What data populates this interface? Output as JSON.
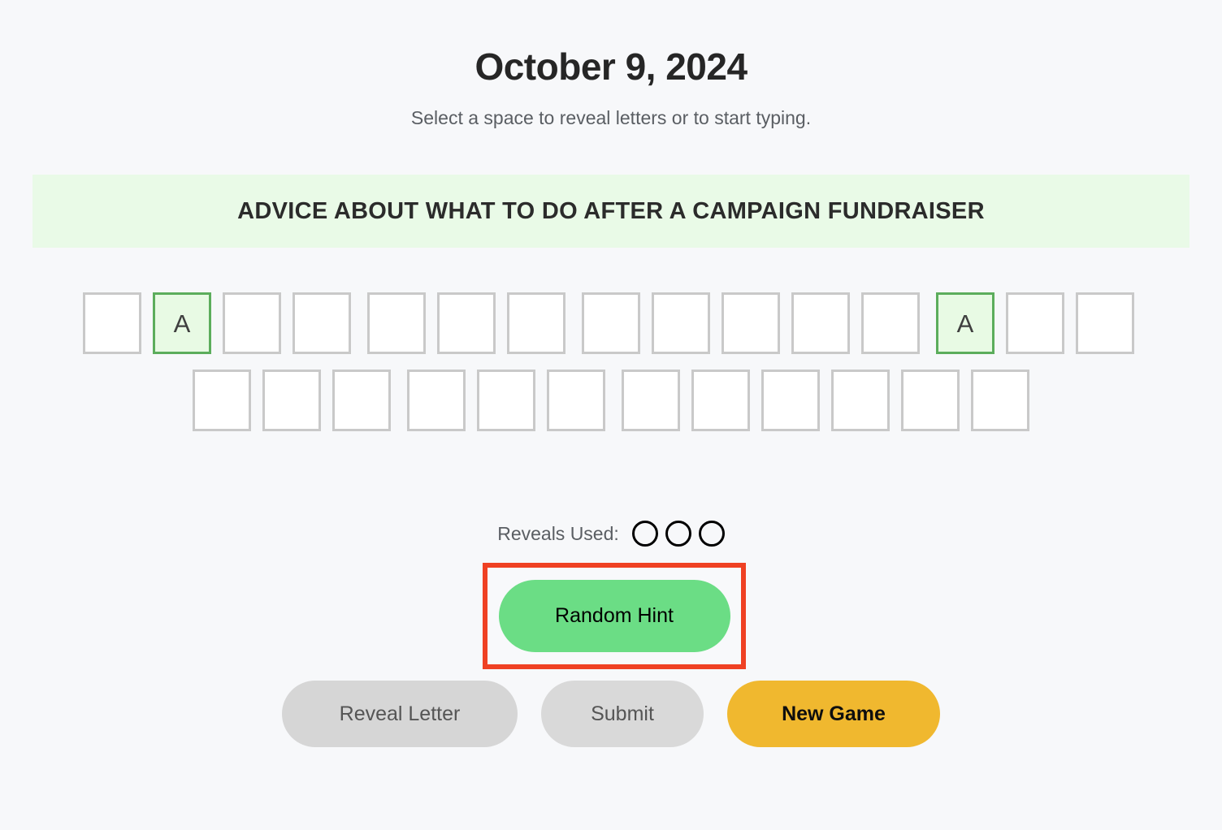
{
  "header": {
    "title": "October 9, 2024",
    "subtitle": "Select a space to reveal letters or to start typing."
  },
  "clue": {
    "text": "ADVICE ABOUT WHAT TO DO AFTER A CAMPAIGN FUNDRAISER",
    "background_color": "#E9FAE7"
  },
  "puzzle": {
    "rows": [
      {
        "groups": [
          {
            "cells": [
              {
                "letter": "",
                "revealed": false
              },
              {
                "letter": "A",
                "revealed": true
              },
              {
                "letter": "",
                "revealed": false
              },
              {
                "letter": "",
                "revealed": false
              }
            ]
          },
          {
            "cells": [
              {
                "letter": "",
                "revealed": false
              },
              {
                "letter": "",
                "revealed": false
              },
              {
                "letter": "",
                "revealed": false
              }
            ]
          },
          {
            "cells": [
              {
                "letter": "",
                "revealed": false
              },
              {
                "letter": "",
                "revealed": false
              },
              {
                "letter": "",
                "revealed": false
              },
              {
                "letter": "",
                "revealed": false
              },
              {
                "letter": "",
                "revealed": false
              }
            ]
          },
          {
            "cells": [
              {
                "letter": "A",
                "revealed": true
              },
              {
                "letter": "",
                "revealed": false
              },
              {
                "letter": "",
                "revealed": false
              }
            ]
          }
        ]
      },
      {
        "groups": [
          {
            "cells": [
              {
                "letter": "",
                "revealed": false
              },
              {
                "letter": "",
                "revealed": false
              },
              {
                "letter": "",
                "revealed": false
              }
            ]
          },
          {
            "cells": [
              {
                "letter": "",
                "revealed": false
              },
              {
                "letter": "",
                "revealed": false
              },
              {
                "letter": "",
                "revealed": false
              }
            ]
          },
          {
            "cells": [
              {
                "letter": "",
                "revealed": false
              },
              {
                "letter": "",
                "revealed": false
              },
              {
                "letter": "",
                "revealed": false
              },
              {
                "letter": "",
                "revealed": false
              },
              {
                "letter": "",
                "revealed": false
              },
              {
                "letter": "",
                "revealed": false
              }
            ]
          }
        ]
      }
    ],
    "revealed_letter_border_color": "#5CAD5C",
    "revealed_letter_fill_color": "#E8FAE4",
    "empty_cell_border_color": "#C9C9C9"
  },
  "reveals": {
    "label": "Reveals Used:",
    "total": 3,
    "used": 0,
    "dots": [
      {
        "used": false
      },
      {
        "used": false
      },
      {
        "used": false
      }
    ]
  },
  "hint": {
    "button_label": "Random Hint",
    "button_color": "#6BDD85",
    "highlight_border_color": "#EF4123"
  },
  "actions": {
    "reveal_letter_label": "Reveal Letter",
    "submit_label": "Submit",
    "new_game_label": "New Game",
    "new_game_color": "#F0B82F"
  }
}
